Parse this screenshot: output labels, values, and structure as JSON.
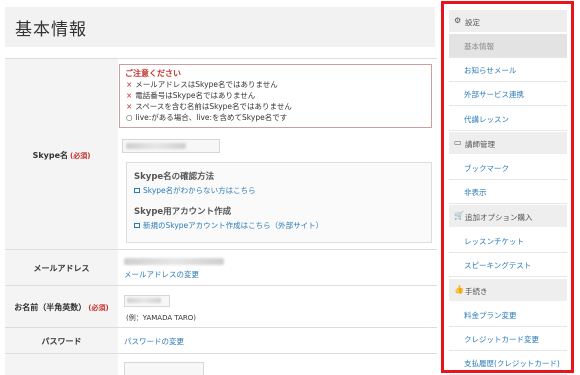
{
  "header": {
    "title": "基本情報"
  },
  "notice": {
    "title": "ご注意ください",
    "lines": [
      {
        "mark": "×",
        "text": "メールアドレスはSkype名ではありません"
      },
      {
        "mark": "×",
        "text": "電話番号はSkype名ではありません"
      },
      {
        "mark": "×",
        "text": "スペースを含む名前はSkype名ではありません"
      },
      {
        "mark": "○",
        "text": "live:がある場合、live:を含めてSkype名です"
      }
    ]
  },
  "form": {
    "skype_label": "Skype名",
    "required": "(必須)",
    "info_head_1": "Skype名の確認方法",
    "info_link_1": "Skype名がわからない方はこちら",
    "info_head_2": "Skype用アカウント作成",
    "info_link_2": "新規のSkypeアカウント作成はこちら（外部サイト）",
    "email_label": "メールアドレス",
    "email_change": "メールアドレスの変更",
    "name_label": "お名前（半角英数）",
    "name_example": "(例：YAMADA TARO)",
    "password_label": "パスワード",
    "password_change": "パスワードの変更"
  },
  "sidebar": {
    "sections": [
      {
        "icon": "gear-icon",
        "glyph": "⚙",
        "label": "設定",
        "items": [
          "基本情報",
          "お知らせメール",
          "外部サービス連携",
          "代講レッスン"
        ],
        "active": 0
      },
      {
        "icon": "folder-icon",
        "glyph": "▭",
        "label": "講師管理",
        "items": [
          "ブックマーク",
          "非表示"
        ],
        "active": -1
      },
      {
        "icon": "cart-icon",
        "glyph": "🛒",
        "label": "追加オプション購入",
        "items": [
          "レッスンチケット",
          "スピーキングテスト"
        ],
        "active": -1
      },
      {
        "icon": "thumbs-up-icon",
        "glyph": "👍",
        "label": "手続き",
        "items": [
          "料金プラン変更",
          "クレジットカード変更",
          "支払履歴(クレジットカード)"
        ],
        "active": -1
      }
    ]
  },
  "colors": {
    "accent_red": "#e8141c",
    "link_blue": "#2a7ab8",
    "required_red": "#c0332b"
  }
}
